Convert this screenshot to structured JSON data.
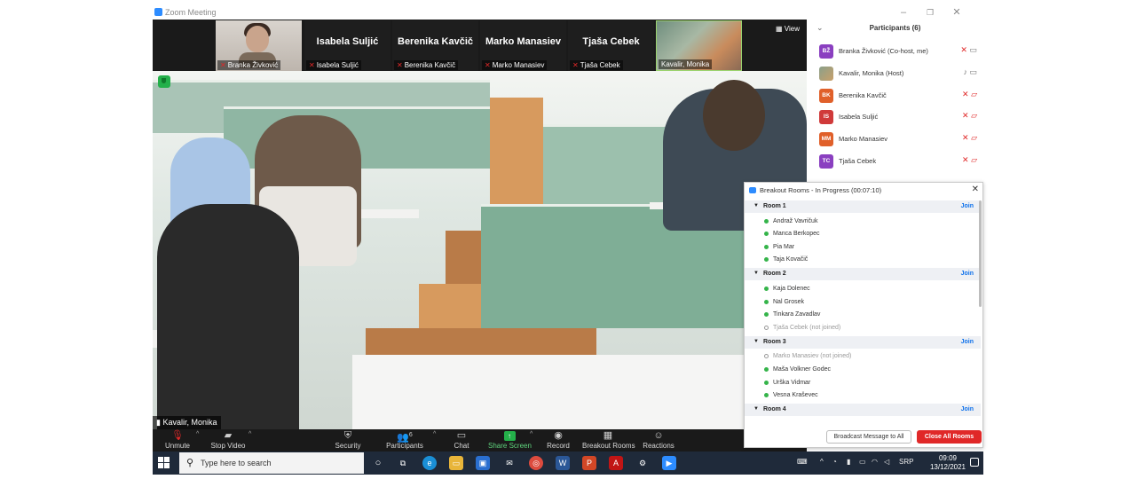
{
  "window": {
    "title": "Zoom Meeting"
  },
  "thumbnails": [
    {
      "name": "",
      "label": "Branka Živković",
      "muted": true,
      "kind": "photo"
    },
    {
      "name": "Isabela Suljić",
      "label": "Isabela Suljić",
      "muted": true,
      "kind": "name"
    },
    {
      "name": "Berenika Kavčič",
      "label": "Berenika Kavčič",
      "muted": true,
      "kind": "name"
    },
    {
      "name": "Marko Manasiev",
      "label": "Marko Manasiev",
      "muted": true,
      "kind": "name"
    },
    {
      "name": "Tjaša Cebek",
      "label": "Tjaša Cebek",
      "muted": true,
      "kind": "name"
    },
    {
      "name": "",
      "label": "Kavalir, Monika",
      "muted": false,
      "kind": "room"
    }
  ],
  "view_label": "View",
  "active_speaker": "Kavalir, Monika",
  "toolbar": {
    "unmute": "Unmute",
    "stop_video": "Stop Video",
    "security": "Security",
    "participants": "Participants",
    "participants_count": "6",
    "chat": "Chat",
    "share_screen": "Share Screen",
    "record": "Record",
    "breakout_rooms": "Breakout Rooms",
    "reactions": "Reactions"
  },
  "participants_panel": {
    "title": "Participants (6)",
    "items": [
      {
        "initials": "BŽ",
        "name": "Branka Živković (Co-host, me)",
        "color": "#8a3fc0",
        "mic": "muted",
        "video": "on"
      },
      {
        "initials": "",
        "name": "Kavalir, Monika (Host)",
        "color": "#7a8a70",
        "mic": "on",
        "video": "on"
      },
      {
        "initials": "BK",
        "name": "Berenika Kavčič",
        "color": "#e0602a",
        "mic": "muted",
        "video": "off"
      },
      {
        "initials": "IS",
        "name": "Isabela Suljić",
        "color": "#d03a3a",
        "mic": "muted",
        "video": "off"
      },
      {
        "initials": "MM",
        "name": "Marko Manasiev",
        "color": "#e0602a",
        "mic": "muted",
        "video": "off"
      },
      {
        "initials": "TC",
        "name": "Tjaša Cebek",
        "color": "#8a3fc0",
        "mic": "muted",
        "video": "off"
      }
    ]
  },
  "breakout": {
    "title": "Breakout Rooms - In Progress (00:07:10)",
    "join_label": "Join",
    "rooms": [
      {
        "name": "Room 1",
        "members": [
          {
            "name": "Andraž Vavričuk",
            "joined": true
          },
          {
            "name": "Manca Berkopec",
            "joined": true
          },
          {
            "name": "Pia Mar",
            "joined": true
          },
          {
            "name": "Taja Kovačič",
            "joined": true
          }
        ]
      },
      {
        "name": "Room 2",
        "members": [
          {
            "name": "Kaja Dolenec",
            "joined": true
          },
          {
            "name": "Nal Grosek",
            "joined": true
          },
          {
            "name": "Tinkara Zavadlav",
            "joined": true
          },
          {
            "name": "Tjaša Cebek (not joined)",
            "joined": false
          }
        ]
      },
      {
        "name": "Room 3",
        "members": [
          {
            "name": "Marko Manasiev (not joined)",
            "joined": false
          },
          {
            "name": "Maša Volkner Godec",
            "joined": true
          },
          {
            "name": "Urška Vidmar",
            "joined": true
          },
          {
            "name": "Vesna Kraševec",
            "joined": true
          }
        ]
      },
      {
        "name": "Room 4",
        "members": []
      }
    ],
    "broadcast_label": "Broadcast Message to All",
    "close_all_label": "Close All Rooms"
  },
  "taskbar": {
    "search_placeholder": "Type here to search",
    "language": "SRP",
    "time": "09:09",
    "date": "13/12/2021"
  },
  "colors": {
    "zoom_blue": "#2d8cff",
    "muted_red": "#e02828",
    "share_green": "#24b14a",
    "taskbar": "#1f2a3a"
  }
}
